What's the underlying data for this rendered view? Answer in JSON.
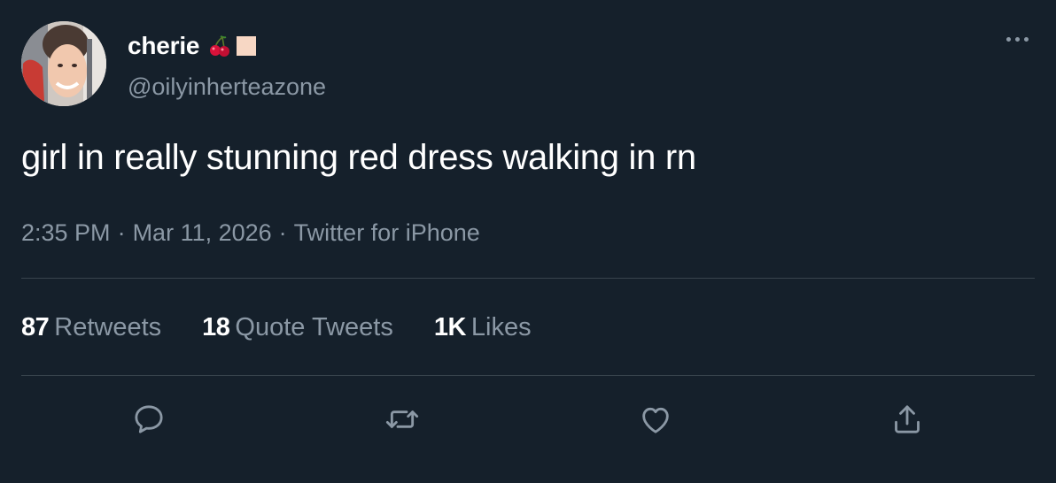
{
  "user": {
    "display_name": "cherie",
    "name_emojis": [
      "cherries-icon",
      "skin-tone-square-icon"
    ],
    "handle": "@oilyinherteazone"
  },
  "tweet": {
    "text": "girl in really stunning red dress walking in rn",
    "time": "2:35 PM",
    "date": "Mar 11, 2026",
    "source": "Twitter for iPhone",
    "separator": "·"
  },
  "stats": {
    "retweets": {
      "count": "87",
      "label": "Retweets"
    },
    "quotes": {
      "count": "18",
      "label": "Quote Tweets"
    },
    "likes": {
      "count": "1K",
      "label": "Likes"
    }
  },
  "icons": {
    "more": "more-horizontal-icon",
    "reply": "reply-icon",
    "retweet": "retweet-icon",
    "like": "heart-icon",
    "share": "share-icon"
  },
  "colors": {
    "background": "#15202b",
    "primary_text": "#ffffff",
    "secondary_text": "#8b98a5",
    "divider": "#38444d",
    "cherry_red": "#d8123a",
    "skin_tone": "#f7d7c4"
  }
}
